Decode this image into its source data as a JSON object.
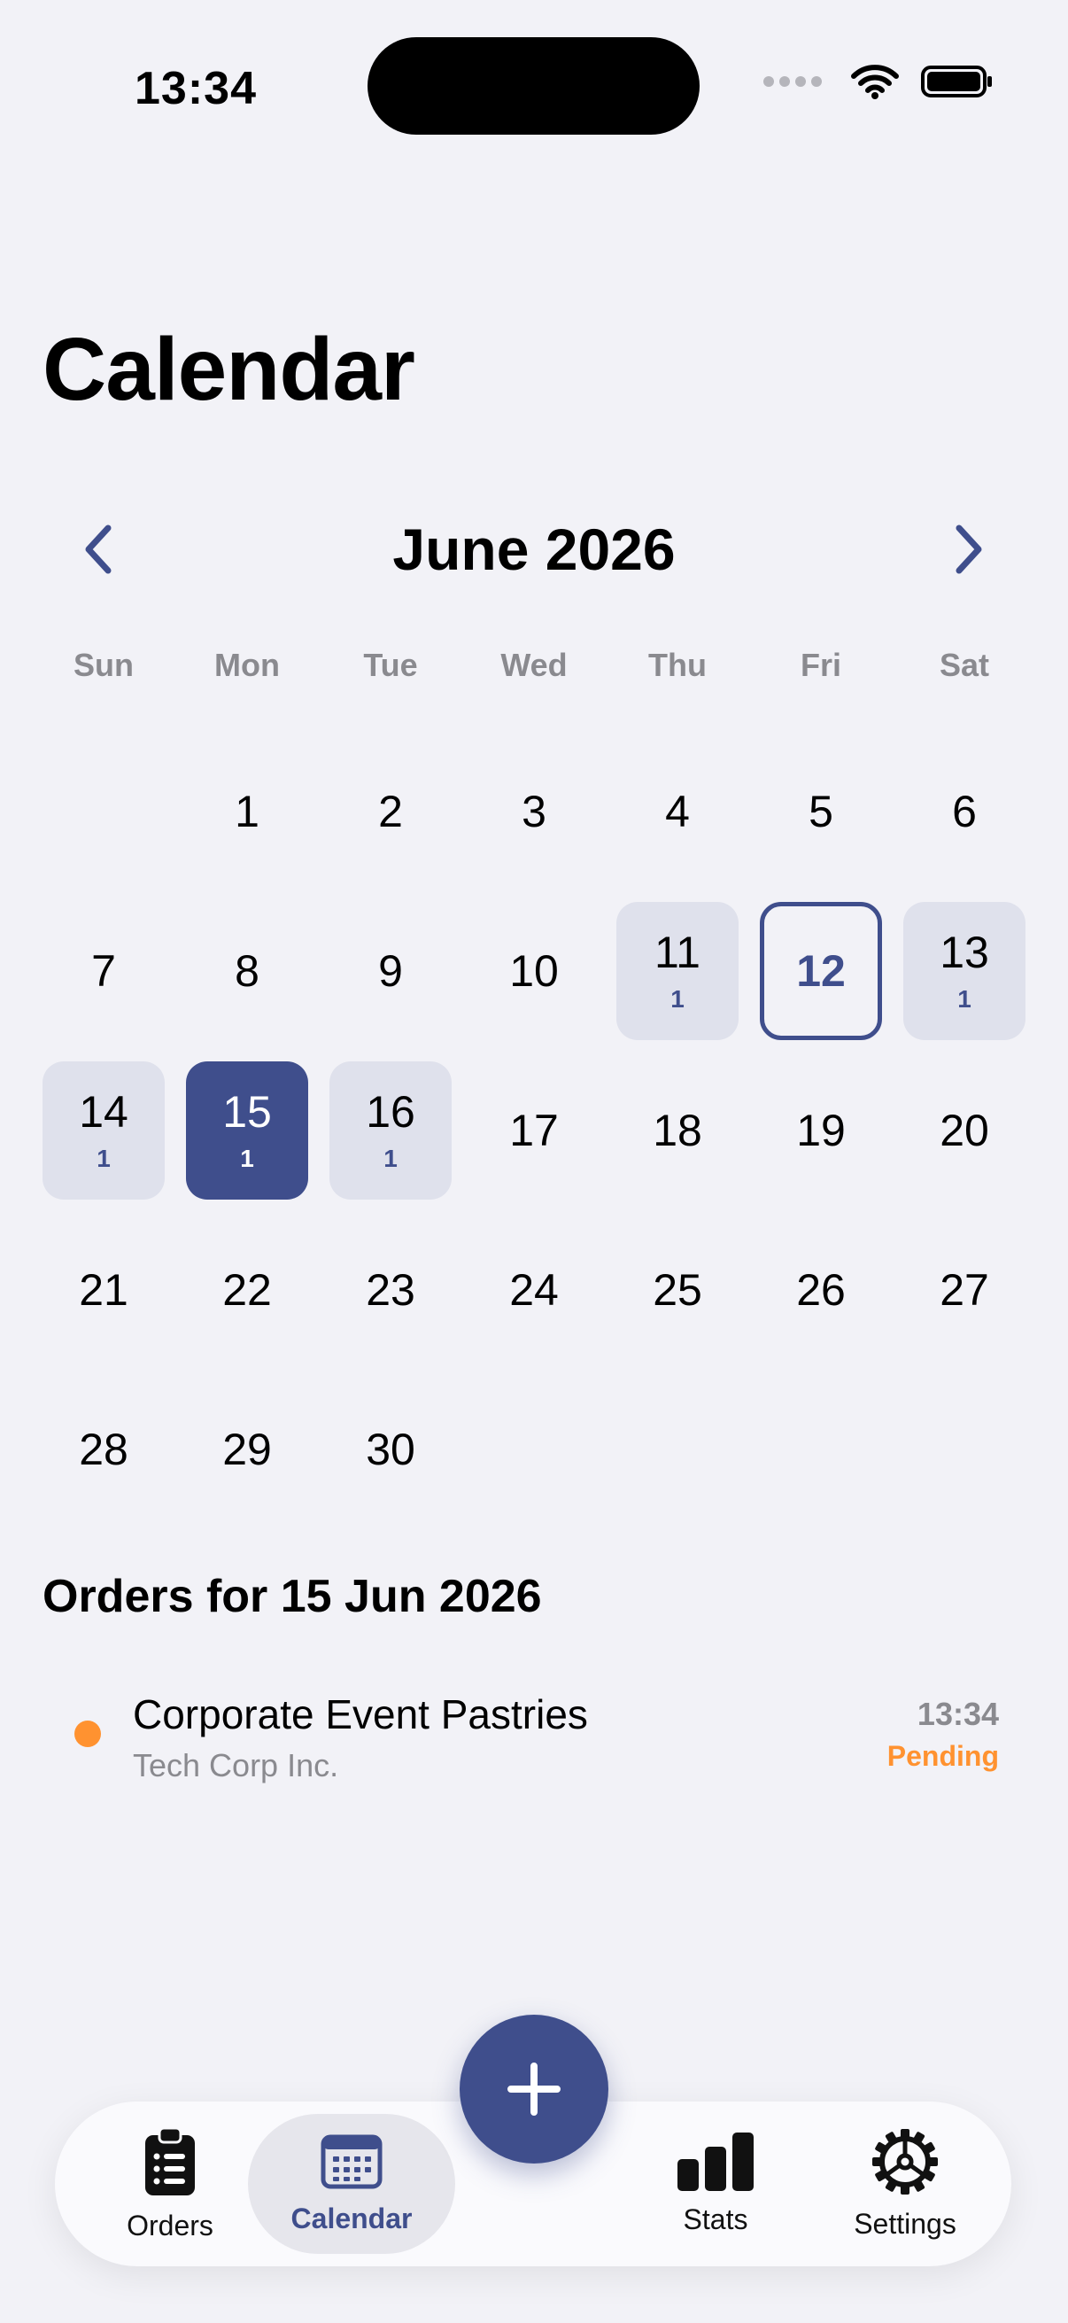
{
  "status_bar": {
    "time": "13:34"
  },
  "page": {
    "title": "Calendar"
  },
  "calendar": {
    "month_label": "June 2026",
    "weekdays": [
      "Sun",
      "Mon",
      "Tue",
      "Wed",
      "Thu",
      "Fri",
      "Sat"
    ],
    "today": 12,
    "selected": 15,
    "days": [
      {
        "num": ""
      },
      {
        "num": "1"
      },
      {
        "num": "2"
      },
      {
        "num": "3"
      },
      {
        "num": "4"
      },
      {
        "num": "5"
      },
      {
        "num": "6"
      },
      {
        "num": "7"
      },
      {
        "num": "8"
      },
      {
        "num": "9"
      },
      {
        "num": "10"
      },
      {
        "num": "11",
        "count": "1"
      },
      {
        "num": "12"
      },
      {
        "num": "13",
        "count": "1"
      },
      {
        "num": "14",
        "count": "1"
      },
      {
        "num": "15",
        "count": "1"
      },
      {
        "num": "16",
        "count": "1"
      },
      {
        "num": "17"
      },
      {
        "num": "18"
      },
      {
        "num": "19"
      },
      {
        "num": "20"
      },
      {
        "num": "21"
      },
      {
        "num": "22"
      },
      {
        "num": "23"
      },
      {
        "num": "24"
      },
      {
        "num": "25"
      },
      {
        "num": "26"
      },
      {
        "num": "27"
      },
      {
        "num": "28"
      },
      {
        "num": "29"
      },
      {
        "num": "30"
      }
    ]
  },
  "orders": {
    "heading": "Orders for 15 Jun 2026",
    "items": [
      {
        "title": "Corporate Event Pastries",
        "customer": "Tech Corp Inc.",
        "time": "13:34",
        "status": "Pending",
        "status_color": "#ff9230"
      }
    ]
  },
  "tab_bar": {
    "tabs": [
      {
        "label": "Orders",
        "icon": "clipboard-icon"
      },
      {
        "label": "Calendar",
        "icon": "calendar-icon",
        "active": true
      },
      {
        "label": "Stats",
        "icon": "bar-chart-icon"
      },
      {
        "label": "Settings",
        "icon": "gear-icon"
      }
    ],
    "fab_icon": "plus-icon"
  },
  "colors": {
    "accent": "#3f4e8c",
    "pending": "#ff9230",
    "background": "#f2f2f7"
  }
}
